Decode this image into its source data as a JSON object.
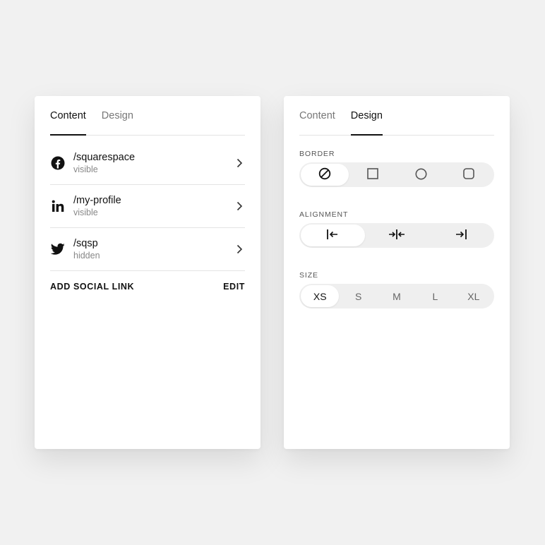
{
  "left_panel": {
    "tabs": [
      {
        "label": "Content",
        "active": true
      },
      {
        "label": "Design",
        "active": false
      }
    ],
    "social_links": [
      {
        "icon": "facebook-icon",
        "handle": "/squarespace",
        "status": "visible"
      },
      {
        "icon": "linkedin-icon",
        "handle": "/my-profile",
        "status": "visible"
      },
      {
        "icon": "twitter-icon",
        "handle": "/sqsp",
        "status": "hidden"
      }
    ],
    "add_label": "ADD SOCIAL LINK",
    "edit_label": "EDIT"
  },
  "right_panel": {
    "tabs": [
      {
        "label": "Content",
        "active": false
      },
      {
        "label": "Design",
        "active": true
      }
    ],
    "border": {
      "label": "BORDER",
      "options": [
        "none-icon",
        "square-icon",
        "circle-icon",
        "rounded-square-icon"
      ],
      "selected": "none"
    },
    "alignment": {
      "label": "ALIGNMENT",
      "options": [
        "align-left-icon",
        "align-center-icon",
        "align-right-icon"
      ],
      "selected": "left"
    },
    "size": {
      "label": "SIZE",
      "options": [
        "XS",
        "S",
        "M",
        "L",
        "XL"
      ],
      "selected": "XS"
    }
  },
  "colors": {
    "background": "#f1f1f1",
    "panel": "#ffffff",
    "text": "#111111",
    "muted": "#888888",
    "segment_bg": "#efefef"
  }
}
